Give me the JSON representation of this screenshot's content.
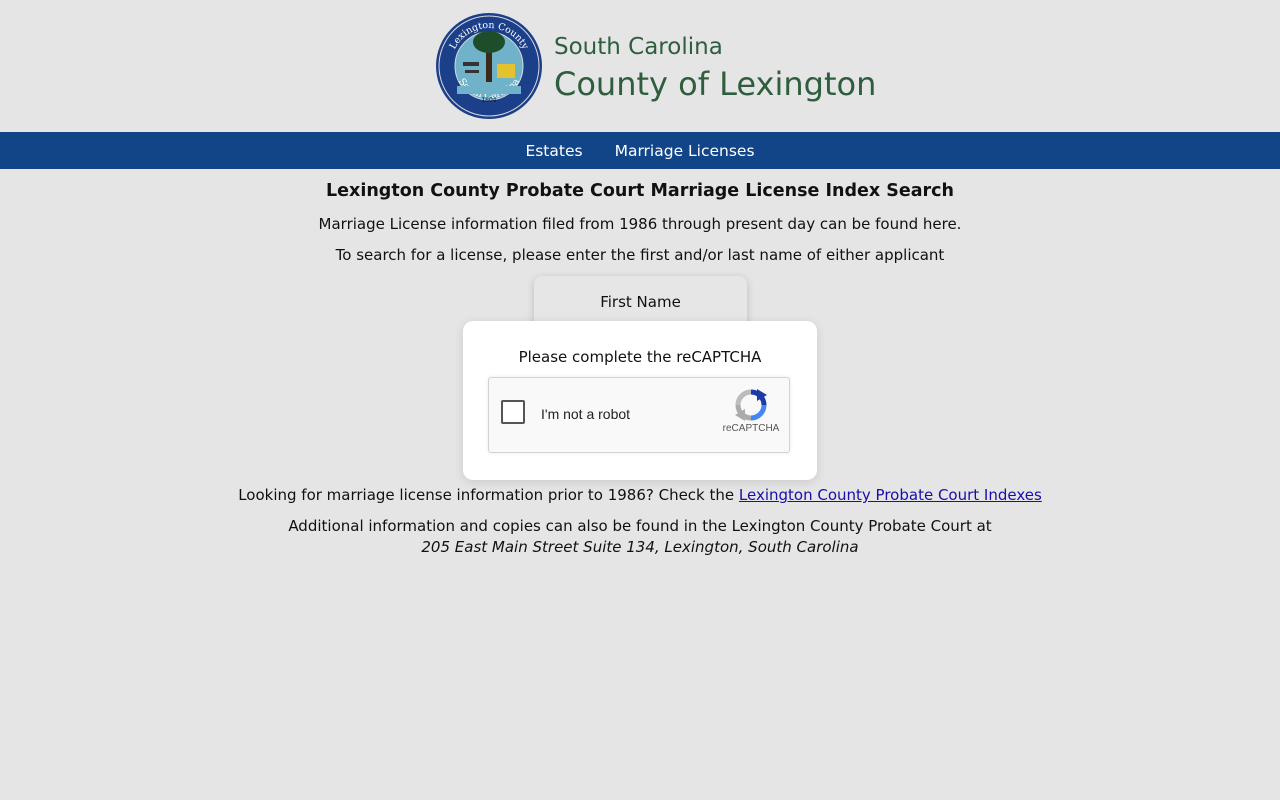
{
  "header": {
    "state": "South Carolina",
    "county": "County of Lexington",
    "seal": {
      "top_text": "Lexington County",
      "bottom_text": "South Carolina",
      "year": "1804"
    }
  },
  "nav": {
    "items": [
      {
        "label": "Estates"
      },
      {
        "label": "Marriage Licenses"
      }
    ]
  },
  "main": {
    "title": "Lexington County Probate Court Marriage License Index Search",
    "intro": "Marriage License information filed from 1986 through present day can be found here.",
    "instructions": "To search for a license, please enter the first and/or last name of either applicant",
    "form": {
      "first_name_label": "First Name"
    }
  },
  "captcha_modal": {
    "prompt": "Please complete the reCAPTCHA",
    "checkbox_label": "I'm not a robot",
    "brand": "reCAPTCHA"
  },
  "footer": {
    "prior_text": "Looking for marriage license information prior to 1986? Check the",
    "prior_link": "Lexington County Probate Court Indexes",
    "additional_text": "Additional information and copies can also be found in the Lexington County Probate Court at",
    "address": "205 East Main Street Suite 134, Lexington, South Carolina"
  },
  "colors": {
    "nav_bg": "#124587",
    "brand_green": "#2e5e3e",
    "page_bg": "#e5e5e5",
    "link": "#1a0dab"
  }
}
